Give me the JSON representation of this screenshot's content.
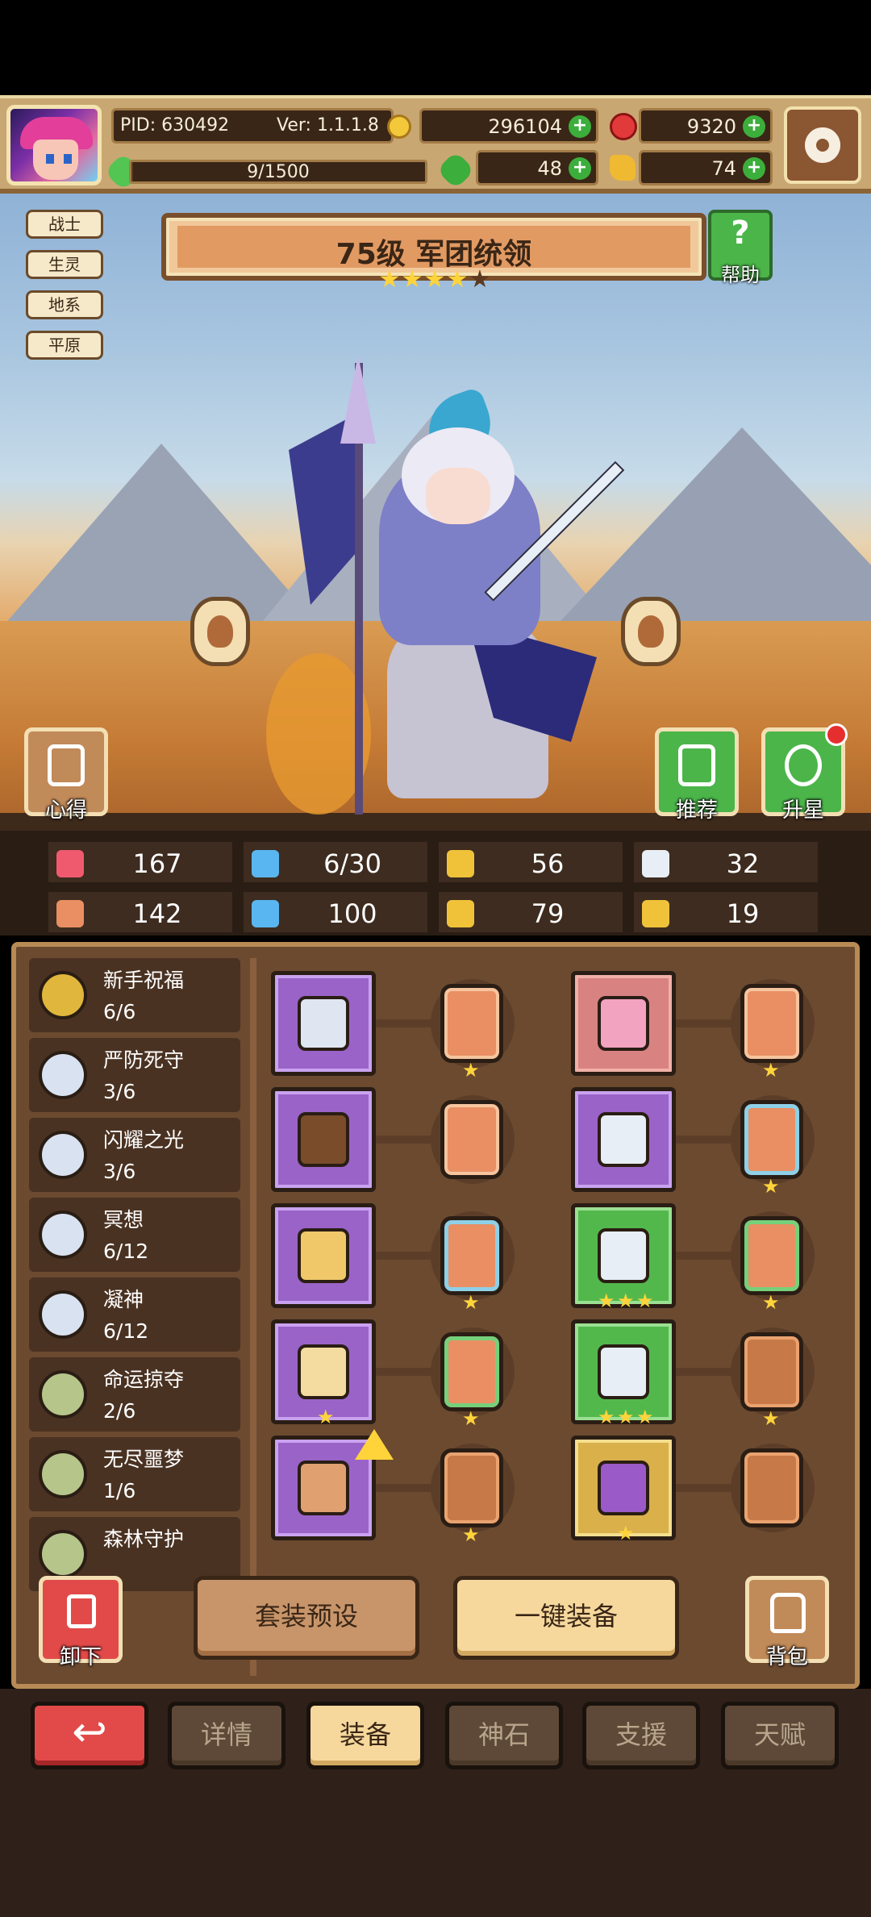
{
  "header": {
    "pid": "PID: 630492",
    "version": "Ver: 1.1.1.8",
    "gold": "296104",
    "gems": "9320",
    "exp": "9/1500",
    "exp_fraction": 0.006,
    "clover": "48",
    "keys": "74",
    "icons": [
      "avatar",
      "coin-icon",
      "ruby-icon",
      "clover-icon",
      "key-icon",
      "gear-icon"
    ]
  },
  "hero": {
    "traits": [
      "战士",
      "生灵",
      "地系",
      "平原"
    ],
    "title": "75级 军团统领",
    "stars_filled": 4,
    "stars_total": 5,
    "help_label": "帮助",
    "buttons": {
      "insight": "心得",
      "recommend": "推荐",
      "star_up": "升星"
    }
  },
  "stats": [
    {
      "icon": "heart-icon",
      "value": "167",
      "color": "#ef5a6f"
    },
    {
      "icon": "mana-icon",
      "value": "6/30",
      "color": "#5ab6f0"
    },
    {
      "icon": "shield-icon",
      "value": "56",
      "color": "#f0c23a"
    },
    {
      "icon": "wing-icon",
      "value": "32",
      "color": "#e8eef6"
    },
    {
      "icon": "fist-icon",
      "value": "142",
      "color": "#e98f63"
    },
    {
      "icon": "book-icon",
      "value": "100",
      "color": "#5ab6f0"
    },
    {
      "icon": "boot-icon",
      "value": "79",
      "color": "#f0c23a"
    },
    {
      "icon": "horseshoe-icon",
      "value": "19",
      "color": "#f0c23a"
    }
  ],
  "sets": [
    {
      "name": "新手祝福",
      "count": "6/6",
      "color": "#e0b63c"
    },
    {
      "name": "严防死守",
      "count": "3/6",
      "color": "#d9e2f0"
    },
    {
      "name": "闪耀之光",
      "count": "3/6",
      "color": "#d9e2f0"
    },
    {
      "name": "冥想",
      "count": "6/12",
      "color": "#d9e2f0"
    },
    {
      "name": "凝神",
      "count": "6/12",
      "color": "#d9e2f0"
    },
    {
      "name": "命运掠夺",
      "count": "2/6",
      "color": "#b6c58a"
    },
    {
      "name": "无尽噩梦",
      "count": "1/6",
      "color": "#b6c58a"
    },
    {
      "name": "森林守护",
      "count": "",
      "color": "#b6c58a"
    }
  ],
  "equipment": {
    "left": [
      {
        "slot": "sword-icon",
        "rarity": "purple",
        "stars": 0,
        "rune": "orange",
        "rune_stars": 1,
        "item_color": "#dfe6f2"
      },
      {
        "slot": "wood-shield-icon",
        "rarity": "purple",
        "stars": 0,
        "rune": "orange",
        "rune_stars": 0,
        "item_color": "#7a4c2a"
      },
      {
        "slot": "necklace-icon",
        "rarity": "purple",
        "stars": 0,
        "rune": "blue",
        "rune_stars": 1,
        "item_color": "#f0c86a"
      },
      {
        "slot": "gem-icon",
        "rarity": "purple",
        "stars": 1,
        "rune": "green",
        "rune_stars": 1,
        "item_color": "#f4dca0"
      },
      {
        "slot": "ring-icon",
        "rarity": "purple",
        "stars": 0,
        "rune": "brown",
        "rune_stars": 1,
        "item_color": "#e0a070",
        "upgrade": true
      }
    ],
    "right": [
      {
        "slot": "helmet-icon",
        "rarity": "pink",
        "stars": 0,
        "rune": "orange",
        "rune_stars": 1,
        "item_color": "#f2a3c0"
      },
      {
        "slot": "armor-icon",
        "rarity": "purple",
        "stars": 0,
        "rune": "blue",
        "rune_stars": 1,
        "item_color": "#e8eef6"
      },
      {
        "slot": "gauntlet-icon",
        "rarity": "green",
        "stars": 3,
        "rune": "green",
        "rune_stars": 1,
        "item_color": "#e8eef6"
      },
      {
        "slot": "belt-icon",
        "rarity": "green",
        "stars": 3,
        "rune": "brown",
        "rune_stars": 1,
        "item_color": "#e8eef6"
      },
      {
        "slot": "boots-icon",
        "rarity": "gold",
        "stars": 1,
        "rune": "brown",
        "rune_stars": 0,
        "item_color": "#9a5ac8"
      }
    ]
  },
  "actions": {
    "unequip": "卸下",
    "preset": "套装预设",
    "equip_all": "一键装备",
    "backpack": "背包"
  },
  "tabs": {
    "back_icon": "↩",
    "details": "详情",
    "equipment": "装备",
    "divine_stone": "神石",
    "support": "支援",
    "talent": "天赋",
    "active": "equipment"
  }
}
